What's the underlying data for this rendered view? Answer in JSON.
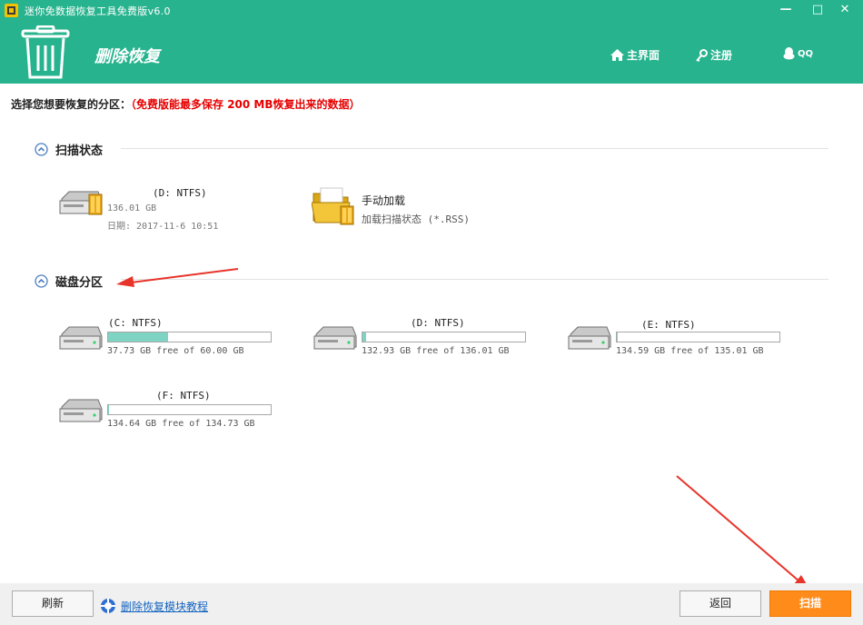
{
  "window": {
    "title": "迷你免数据恢复工具免费版v6.0",
    "minimize": "—",
    "maximize": "□",
    "close": "✕"
  },
  "header": {
    "app_name": "删除恢复",
    "nav": {
      "home": "主界面",
      "register": "注册",
      "qq": "QQ"
    }
  },
  "prompt": {
    "label": "选择您想要恢复的分区：",
    "note": "（免费版能最多保存 200 MB恢复出来的数据）"
  },
  "scan_state_section": {
    "title": "扫描状态",
    "saved_scan": {
      "name": "(D: NTFS)",
      "size": "136.01 GB",
      "date": "日期: 2017-11-6 10:51"
    },
    "manual_load": {
      "title": "手动加载",
      "subtitle": "加载扫描状态 (*.RSS)"
    }
  },
  "partitions_section": {
    "title": "磁盘分区",
    "partitions": [
      {
        "name": "(C: NTFS)",
        "free_text": "37.73 GB free of 60.00 GB",
        "used_fraction": 0.371
      },
      {
        "name": "(D: NTFS)",
        "free_text": "132.93 GB free of 136.01 GB",
        "used_fraction": 0.023
      },
      {
        "name": "(E: NTFS)",
        "free_text": "134.59 GB free of 135.01 GB",
        "used_fraction": 0.003
      },
      {
        "name": "(F: NTFS)",
        "free_text": "134.64 GB free of 134.73 GB",
        "used_fraction": 0.001
      }
    ]
  },
  "footer": {
    "refresh": "刷新",
    "tutorial": "删除恢复模块教程",
    "back": "返回",
    "scan": "扫描"
  },
  "colors": {
    "brand_green": "#27b38e",
    "accent_orange": "#ff8c1a",
    "warning_red": "#e60000",
    "bar_fill": "#7ed3c3"
  }
}
